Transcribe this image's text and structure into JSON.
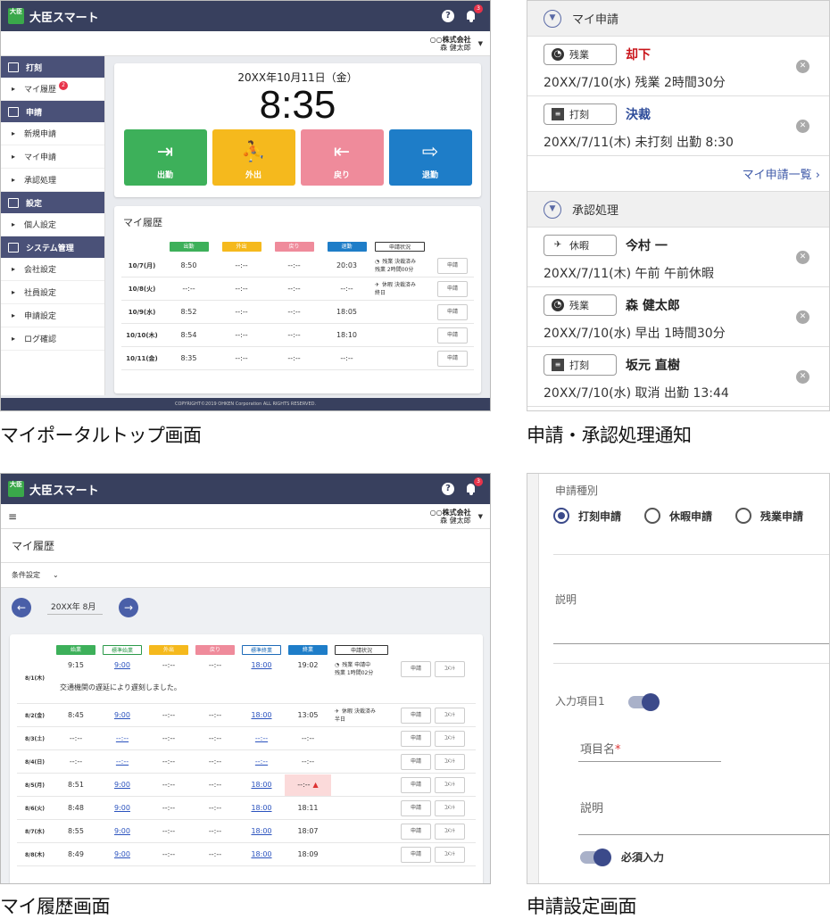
{
  "captions": {
    "portal": "マイポータルトップ画面",
    "notify": "申請・承認処理通知",
    "history": "マイ履歴画面",
    "settings": "申請設定画面"
  },
  "app": {
    "logo": "大臣",
    "title": "大臣スマート",
    "help": "?",
    "bell_count": "3",
    "company": "○○株式会社",
    "user": "森 健太郎",
    "footer": "COPYRIGHT©2019 OHKEN Corporation ALL RIGHTS RESERVED."
  },
  "sidebar": {
    "sections": [
      {
        "title": "打刻",
        "items": [
          {
            "label": "マイ履歴",
            "badge": "2"
          }
        ]
      },
      {
        "title": "申請",
        "items": [
          {
            "label": "新規申請"
          },
          {
            "label": "マイ申請"
          },
          {
            "label": "承認処理"
          }
        ]
      },
      {
        "title": "設定",
        "items": [
          {
            "label": "個人設定"
          }
        ]
      },
      {
        "title": "システム管理",
        "items": [
          {
            "label": "会社設定"
          },
          {
            "label": "社員設定"
          },
          {
            "label": "申請設定"
          },
          {
            "label": "ログ確認"
          }
        ]
      }
    ]
  },
  "clock": {
    "date": "20XX年10月11日（金）",
    "time": "8:35",
    "buttons": [
      {
        "label": "出勤",
        "icon": "⇥",
        "color": "#3db05a"
      },
      {
        "label": "外出",
        "icon": "⛹",
        "color": "#f5b91d"
      },
      {
        "label": "戻り",
        "icon": "⇤",
        "color": "#ef8b9b"
      },
      {
        "label": "退勤",
        "icon": "⇨",
        "color": "#1e7dc8"
      }
    ]
  },
  "history1": {
    "title": "マイ履歴",
    "headers": [
      {
        "label": "出勤",
        "color": "#3db05a"
      },
      {
        "label": "外出",
        "color": "#f5b91d"
      },
      {
        "label": "戻り",
        "color": "#ef8b9b"
      },
      {
        "label": "退勤",
        "color": "#1e7dc8"
      },
      {
        "label": "申請状況",
        "color": "outline"
      }
    ],
    "apply": "申請",
    "rows": [
      {
        "date": "10/7(月)",
        "in": "8:50",
        "out": "--:--",
        "back": "--:--",
        "leave": "20:03",
        "status": "残業 決裁済み",
        "status2": "残業 2時間00分",
        "icon": "◔"
      },
      {
        "date": "10/8(火)",
        "in": "--:--",
        "out": "--:--",
        "back": "--:--",
        "leave": "--:--",
        "status": "休暇 決裁済み",
        "status2": "終日",
        "icon": "✈"
      },
      {
        "date": "10/9(水)",
        "in": "8:52",
        "out": "--:--",
        "back": "--:--",
        "leave": "18:05",
        "status": "",
        "status2": "",
        "icon": ""
      },
      {
        "date": "10/10(木)",
        "in": "8:54",
        "out": "--:--",
        "back": "--:--",
        "leave": "18:10",
        "status": "",
        "status2": "",
        "icon": ""
      },
      {
        "date": "10/11(金)",
        "in": "8:35",
        "out": "--:--",
        "back": "--:--",
        "leave": "--:--",
        "status": "",
        "status2": "",
        "icon": ""
      }
    ]
  },
  "notify": {
    "my_section": "マイ申請",
    "my_items": [
      {
        "kind": "残業",
        "icon": "◔",
        "status": "却下",
        "status_color": "#c9141a",
        "line": "20XX/7/10(水) 残業 2時間30分"
      },
      {
        "kind": "打刻",
        "icon": "≡",
        "status": "決裁",
        "status_color": "#2e4c9a",
        "line": "20XX/7/11(木) 未打刻 出勤 8:30"
      }
    ],
    "more": "マイ申請一覧 ›",
    "approve_section": "承認処理",
    "approve_items": [
      {
        "kind": "休暇",
        "icon": "✈",
        "status": "今村 一",
        "status_color": "#222",
        "line": "20XX/7/11(木) 午前 午前休暇"
      },
      {
        "kind": "残業",
        "icon": "◔",
        "status": "森 健太郎",
        "status_color": "#222",
        "line": "20XX/7/10(水) 早出 1時間30分"
      },
      {
        "kind": "打刻",
        "icon": "≡",
        "status": "坂元 直樹",
        "status_color": "#222",
        "line": "20XX/7/10(水) 取消 出勤 13:44"
      }
    ]
  },
  "history2": {
    "menu": "≡",
    "title": "マイ履歴",
    "filter": "条件設定",
    "month": "20XX年 8月",
    "headers": [
      {
        "label": "始業",
        "color": "#3db05a"
      },
      {
        "label": "標準始業",
        "color": "outline-green"
      },
      {
        "label": "外出",
        "color": "#f5b91d"
      },
      {
        "label": "戻り",
        "color": "#ef8b9b"
      },
      {
        "label": "標準終業",
        "color": "outline-blue"
      },
      {
        "label": "終業",
        "color": "#1e7dc8"
      },
      {
        "label": "申請状況",
        "color": "outline"
      }
    ],
    "apply": "申請",
    "comment": "ｺﾒﾝﾄ",
    "rows": [
      {
        "date": "8/1(木)",
        "a": "9:15",
        "b": "9:00",
        "c": "--:--",
        "d": "--:--",
        "e": "18:00",
        "f": "19:02",
        "status": "残業 申請中",
        "status2": "残業 1時間02分",
        "icon": "◔",
        "note": "交通機関の遅延により遅刻しました。",
        "warn": false
      },
      {
        "date": "8/2(金)",
        "a": "8:45",
        "b": "9:00",
        "c": "--:--",
        "d": "--:--",
        "e": "18:00",
        "f": "13:05",
        "status": "休暇 決裁済み",
        "status2": "半日",
        "icon": "✈",
        "note": "",
        "warn": false
      },
      {
        "date": "8/3(土)",
        "a": "--:--",
        "b": "--:--",
        "c": "--:--",
        "d": "--:--",
        "e": "--:--",
        "f": "--:--",
        "status": "",
        "status2": "",
        "icon": "",
        "note": "",
        "warn": false
      },
      {
        "date": "8/4(日)",
        "a": "--:--",
        "b": "--:--",
        "c": "--:--",
        "d": "--:--",
        "e": "--:--",
        "f": "--:--",
        "status": "",
        "status2": "",
        "icon": "",
        "note": "",
        "warn": false
      },
      {
        "date": "8/5(月)",
        "a": "8:51",
        "b": "9:00",
        "c": "--:--",
        "d": "--:--",
        "e": "18:00",
        "f": "--:--",
        "status": "",
        "status2": "",
        "icon": "",
        "note": "",
        "warn": true
      },
      {
        "date": "8/6(火)",
        "a": "8:48",
        "b": "9:00",
        "c": "--:--",
        "d": "--:--",
        "e": "18:00",
        "f": "18:11",
        "status": "",
        "status2": "",
        "icon": "",
        "note": "",
        "warn": false
      },
      {
        "date": "8/7(水)",
        "a": "8:55",
        "b": "9:00",
        "c": "--:--",
        "d": "--:--",
        "e": "18:00",
        "f": "18:07",
        "status": "",
        "status2": "",
        "icon": "",
        "note": "",
        "warn": false
      },
      {
        "date": "8/8(木)",
        "a": "8:49",
        "b": "9:00",
        "c": "--:--",
        "d": "--:--",
        "e": "18:00",
        "f": "18:09",
        "status": "",
        "status2": "",
        "icon": "",
        "note": "",
        "warn": false
      }
    ]
  },
  "settings": {
    "type_label": "申請種別",
    "options": [
      {
        "label": "打刻申請",
        "selected": true
      },
      {
        "label": "休暇申請",
        "selected": false
      },
      {
        "label": "残業申請",
        "selected": false
      }
    ],
    "desc_label": "説明",
    "item_label": "入力項目1",
    "item_name_label": "項目名",
    "required_mark": "*",
    "item_desc_label": "説明",
    "required_label": "必須入力"
  }
}
